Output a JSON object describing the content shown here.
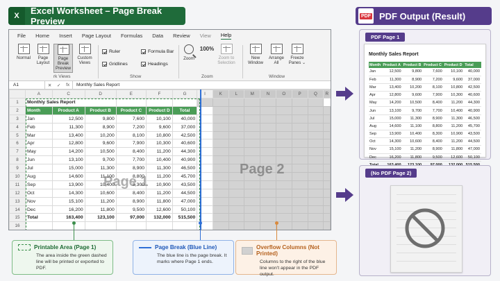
{
  "left_banner": {
    "icon_letter": "X",
    "title": "Excel Worksheet – Page Break Preview"
  },
  "right_banner": {
    "icon_text": "PDF",
    "title": "PDF Output (Result)"
  },
  "excel": {
    "menu": [
      "File",
      "Home",
      "Insert",
      "Page Layout",
      "Formulas",
      "Data",
      "Review",
      "View",
      "Help"
    ],
    "active_menu": "Help",
    "ribbon": {
      "normal": "Normal",
      "page_layout": "Page Layout",
      "page_break_preview": "Page Break Preview",
      "custom_views": "Custom Views",
      "group_views": "rk Views",
      "ruler": "Ruler",
      "gridlines": "Gridlines",
      "formula_bar": "Formula Bar",
      "headings": "Headings",
      "group_show": "Show",
      "zoom": "Zoom",
      "zoom_100": "100%",
      "zoom_to_selection": "Zoom to Selection",
      "group_zoom": "Zoom",
      "new_window": "New Window",
      "arrange_all": "Arrange All",
      "freeze_panes": "Freeze Panes ⌄",
      "group_window": "Window"
    },
    "name_box": "A1",
    "fx": "fx",
    "formula_content": "Monthly Sales Report",
    "col_headers": [
      "A",
      "C",
      "D",
      "E",
      "F",
      "G",
      "I",
      "K",
      "L",
      "M",
      "N",
      "O",
      "P",
      "Q",
      "R"
    ],
    "row_numbers": [
      "1",
      "2",
      "3",
      "4",
      "5",
      "6",
      "7",
      "8",
      "9",
      "10",
      "11",
      "12",
      "13",
      "14",
      "15",
      "16",
      "17",
      "18"
    ],
    "report_title": "Monthly Sales Report",
    "table_headers": [
      "Month",
      "Product A",
      "Product B",
      "Product C",
      "Product D",
      "Total"
    ],
    "rows": [
      [
        "Jan",
        "12,500",
        "9,800",
        "7,600",
        "10,100",
        "40,000"
      ],
      [
        "Feb",
        "11,300",
        "8,900",
        "7,200",
        "9,600",
        "37,000"
      ],
      [
        "Mar",
        "13,400",
        "10,200",
        "8,100",
        "10,800",
        "42,500"
      ],
      [
        "Apr",
        "12,800",
        "9,600",
        "7,900",
        "10,300",
        "40,600"
      ],
      [
        "May",
        "14,200",
        "10,500",
        "8,400",
        "11,200",
        "44,300"
      ],
      [
        "Jun",
        "13,100",
        "9,700",
        "7,700",
        "10,400",
        "40,900"
      ],
      [
        "Jul",
        "15,000",
        "11,300",
        "8,900",
        "11,300",
        "46,500"
      ],
      [
        "Aug",
        "14,600",
        "11,100",
        "8,800",
        "11,200",
        "45,700"
      ],
      [
        "Sep",
        "13,900",
        "10,400",
        "8,300",
        "10,900",
        "43,500"
      ],
      [
        "Oct",
        "14,300",
        "10,600",
        "8,400",
        "11,200",
        "44,500"
      ],
      [
        "Nov",
        "15,100",
        "11,200",
        "8,900",
        "11,800",
        "47,000"
      ],
      [
        "Dec",
        "16,200",
        "11,800",
        "9,500",
        "12,600",
        "50,100"
      ]
    ],
    "total_row": [
      "Total",
      "163,400",
      "123,100",
      "97,000",
      "132,000",
      "515,500"
    ],
    "watermark_page1": "Page 1",
    "watermark_page2": "Page 2"
  },
  "callouts": [
    {
      "title": "Printable Area (Page 1)",
      "text": "The area inside the green dashed line will be printed or exported to PDF."
    },
    {
      "title": "Page Break (Blue Line)",
      "text": "The blue line is the page break. It marks where Page 1 ends."
    },
    {
      "title": "Overflow Columns (Not Printed)",
      "text": "Columns to the right of the blue line won't appear in the PDF output."
    }
  ],
  "pdf": {
    "page1_label": "PDF Page 1",
    "page2_label": "(No PDF Page 2)",
    "report_title": "Monthly Sales Report",
    "table_headers": [
      "Month",
      "Product A",
      "Product B",
      "Product C",
      "Product D",
      "Total"
    ],
    "rows": [
      [
        "Jan",
        "12,500",
        "9,800",
        "7,600",
        "10,100",
        "40,000"
      ],
      [
        "Feb",
        "11,300",
        "8,900",
        "7,200",
        "9,600",
        "37,000"
      ],
      [
        "Mar",
        "13,400",
        "10,200",
        "8,100",
        "10,800",
        "42,500"
      ],
      [
        "Apr",
        "12,800",
        "9,600",
        "7,900",
        "10,300",
        "40,600"
      ],
      [
        "May",
        "14,200",
        "10,500",
        "8,400",
        "11,200",
        "44,300"
      ],
      [
        "Jun",
        "13,100",
        "9,700",
        "7,700",
        "10,400",
        "40,900"
      ],
      [
        "Jul",
        "15,000",
        "11,300",
        "8,900",
        "11,300",
        "46,500"
      ],
      [
        "Aug",
        "14,600",
        "11,100",
        "8,800",
        "11,200",
        "45,700"
      ],
      [
        "Sep",
        "13,900",
        "10,400",
        "8,300",
        "10,900",
        "43,500"
      ],
      [
        "Oct",
        "14,300",
        "10,600",
        "8,400",
        "11,200",
        "44,500"
      ],
      [
        "Nov",
        "15,100",
        "11,200",
        "8,900",
        "11,800",
        "47,000"
      ],
      [
        "Dec",
        "16,200",
        "11,800",
        "9,500",
        "12,600",
        "50,100"
      ]
    ],
    "total_row": [
      "Total",
      "163,400",
      "123,100",
      "97,000",
      "132,000",
      "515,500"
    ]
  },
  "colors": {
    "excel_green": "#1f6b3a",
    "table_header_green": "#4a9d57",
    "page_break_blue": "#2f6fd6",
    "overflow_gray": "#d3d3d3",
    "pdf_purple": "#553c8b",
    "orange_accent": "#d98a3d"
  }
}
